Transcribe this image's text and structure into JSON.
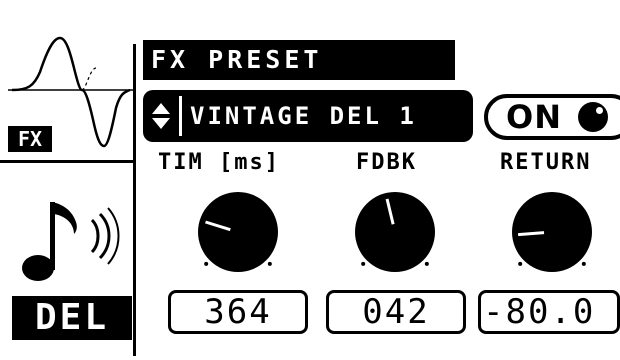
{
  "sidebar": {
    "fx_icon": "fx-waveform-icon",
    "fx_label": "FX",
    "note_icon": "music-note-sound-icon",
    "mode_label": "DEL"
  },
  "header": {
    "title": "FX PRESET",
    "preset_name": "VINTAGE DEL 1",
    "selector_icon": "up-down-arrows-icon",
    "toggle_label": "ON"
  },
  "knobs": [
    {
      "label": "TIM [ms]",
      "value": "364",
      "level": 0.23
    },
    {
      "label": "FDBK",
      "value": "042",
      "level": 0.45
    },
    {
      "label": "RETURN",
      "value": "-80.0",
      "level": 0.15
    }
  ],
  "colors": {
    "foreground": "#000000",
    "background": "#ffffff"
  }
}
